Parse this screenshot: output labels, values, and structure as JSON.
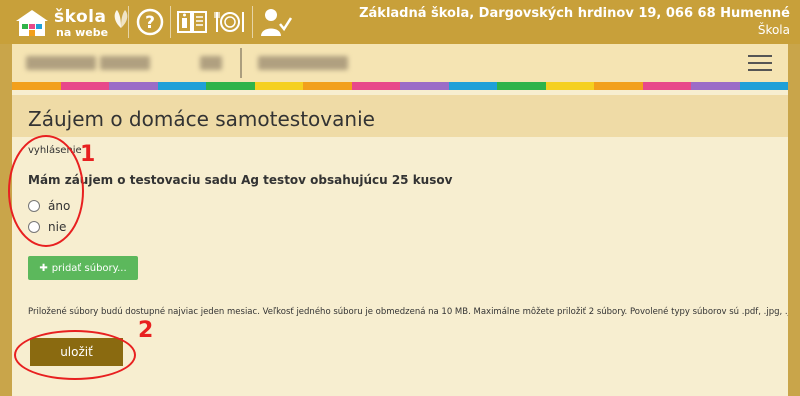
{
  "header": {
    "logo_line1": "škola",
    "logo_line2": "na webe",
    "school_name": "Základná škola, Dargovských hrdinov 19, 066 68 Humenné",
    "school_type": "Škola"
  },
  "icons": [
    "help-icon",
    "homework-book-icon",
    "lunch-plate-icon",
    "teacher-check-icon",
    "hamburger-menu-icon"
  ],
  "stripe_colors": [
    "#f2a01c",
    "#e8488a",
    "#9b6cc7",
    "#1fa0d8",
    "#2fb34a",
    "#f5d020",
    "#f2a01c",
    "#e8488a",
    "#9b6cc7",
    "#1fa0d8",
    "#2fb34a",
    "#f5d020",
    "#f2a01c",
    "#e8488a",
    "#9b6cc7",
    "#1fa0d8"
  ],
  "main": {
    "title": "Záujem o domáce samotestovanie",
    "label": "vyhlásenie",
    "question": "Mám záujem o testovaciu sadu Ag testov obsahujúcu 25 kusov",
    "options": [
      "áno",
      "nie"
    ],
    "add_files": "pridať súbory...",
    "info": "Priložené súbory budú dostupné najviac jeden mesiac. Veľkosť jedného súboru je obmedzená na 10 MB. Maximálne môžete priložiť 2 súbory. Povolené typy súborov sú .pdf, .jpg, .jpeg, .png.",
    "save": "uložiť"
  },
  "annotations": [
    "1",
    "2"
  ],
  "annotation_color": "#e82020"
}
